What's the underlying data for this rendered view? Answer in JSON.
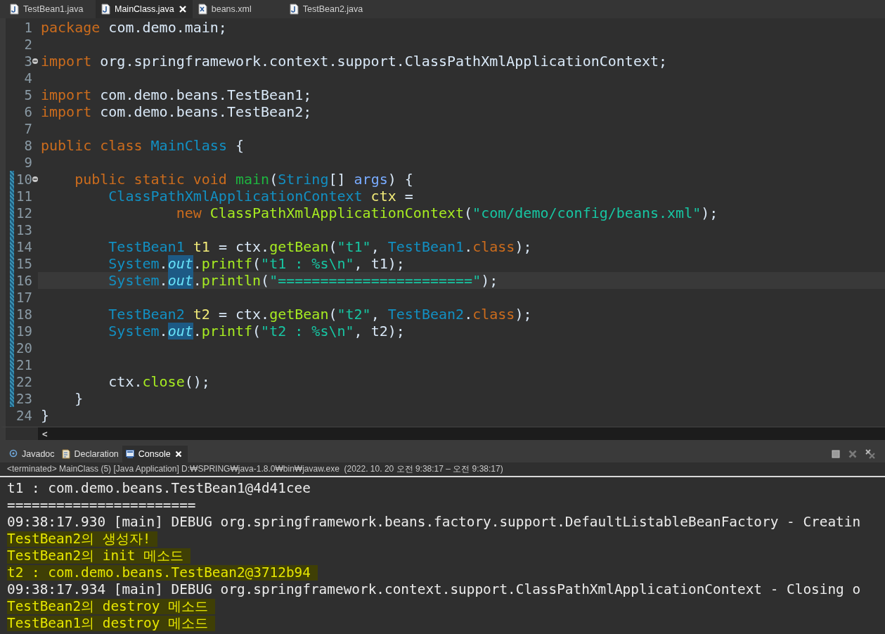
{
  "editor_tabs": [
    {
      "label": "TestBean1.java",
      "kind": "java",
      "selected": false
    },
    {
      "label": "MainClass.java",
      "kind": "java",
      "selected": true
    },
    {
      "label": "beans.xml",
      "kind": "xml",
      "selected": false
    },
    {
      "label": "TestBean2.java",
      "kind": "java",
      "selected": false
    }
  ],
  "code_lines": [
    {
      "number": "1",
      "fold_marker": false,
      "marked": false,
      "current": false,
      "tokens": [
        {
          "kind": "kw",
          "text": "package"
        },
        {
          "kind": "plain",
          "text": " com.demo.main;"
        }
      ]
    },
    {
      "number": "2",
      "fold_marker": false,
      "marked": false,
      "current": false
    },
    {
      "number": "3",
      "fold_marker": true,
      "marked": false,
      "current": false,
      "tokens": [
        {
          "kind": "kw",
          "text": "import"
        },
        {
          "kind": "plain",
          "text": " org.springframework.context.support.ClassPathXmlApplicationContext;"
        }
      ]
    },
    {
      "number": "4",
      "fold_marker": false,
      "marked": false,
      "current": false
    },
    {
      "number": "5",
      "fold_marker": false,
      "marked": false,
      "current": false,
      "tokens": [
        {
          "kind": "kw",
          "text": "import"
        },
        {
          "kind": "plain",
          "text": " com.demo.beans.TestBean1;"
        }
      ]
    },
    {
      "number": "6",
      "fold_marker": false,
      "marked": false,
      "current": false,
      "tokens": [
        {
          "kind": "kw",
          "text": "import"
        },
        {
          "kind": "plain",
          "text": " com.demo.beans.TestBean2;"
        }
      ]
    },
    {
      "number": "7",
      "fold_marker": false,
      "marked": false,
      "current": false
    },
    {
      "number": "8",
      "fold_marker": false,
      "marked": false,
      "current": false,
      "tokens": [
        {
          "kind": "kw",
          "text": "public class "
        },
        {
          "kind": "type",
          "text": "MainClass"
        },
        {
          "kind": "plain",
          "text": " {"
        }
      ]
    },
    {
      "number": "9",
      "fold_marker": false,
      "marked": false,
      "current": false
    },
    {
      "number": "10",
      "fold_marker": true,
      "marked": true,
      "current": false,
      "tokens": [
        {
          "kind": "kw",
          "text": "    public static void "
        },
        {
          "kind": "method_decl",
          "text": "main"
        },
        {
          "kind": "plain",
          "text": "("
        },
        {
          "kind": "type",
          "text": "String"
        },
        {
          "kind": "plain",
          "text": "[] "
        },
        {
          "kind": "param",
          "text": "args"
        },
        {
          "kind": "plain",
          "text": ") {"
        }
      ]
    },
    {
      "number": "11",
      "fold_marker": false,
      "marked": true,
      "current": false,
      "tokens": [
        {
          "kind": "type",
          "text": "        ClassPathXmlApplicationContext "
        },
        {
          "kind": "var_decl",
          "text": "ctx"
        },
        {
          "kind": "plain",
          "text": " ="
        }
      ]
    },
    {
      "number": "12",
      "fold_marker": false,
      "marked": true,
      "current": false,
      "tokens": [
        {
          "kind": "kw",
          "text": "                new "
        },
        {
          "kind": "method",
          "text": "ClassPathXmlApplicationContext"
        },
        {
          "kind": "plain",
          "text": "("
        },
        {
          "kind": "str",
          "text": "\"com/demo/config/beans.xml\""
        },
        {
          "kind": "plain",
          "text": ");"
        }
      ]
    },
    {
      "number": "13",
      "fold_marker": false,
      "marked": true,
      "current": false
    },
    {
      "number": "14",
      "fold_marker": false,
      "marked": true,
      "current": false,
      "tokens": [
        {
          "kind": "type",
          "text": "        TestBean1 "
        },
        {
          "kind": "var_decl",
          "text": "t1"
        },
        {
          "kind": "plain",
          "text": " = ctx."
        },
        {
          "kind": "method",
          "text": "getBean"
        },
        {
          "kind": "plain",
          "text": "("
        },
        {
          "kind": "str",
          "text": "\"t1\""
        },
        {
          "kind": "plain",
          "text": ", "
        },
        {
          "kind": "type",
          "text": "TestBean1"
        },
        {
          "kind": "plain",
          "text": "."
        },
        {
          "kind": "kw",
          "text": "class"
        },
        {
          "kind": "plain",
          "text": ");"
        }
      ]
    },
    {
      "number": "15",
      "fold_marker": false,
      "marked": true,
      "current": false,
      "tokens": [
        {
          "kind": "type",
          "text": "        System"
        },
        {
          "kind": "plain",
          "text": "."
        },
        {
          "kind": "field_occurrence",
          "text": "out"
        },
        {
          "kind": "plain",
          "text": "."
        },
        {
          "kind": "method",
          "text": "printf"
        },
        {
          "kind": "plain",
          "text": "("
        },
        {
          "kind": "str",
          "text": "\"t1 : %s\\n\""
        },
        {
          "kind": "plain",
          "text": ", t1);"
        }
      ]
    },
    {
      "number": "16",
      "fold_marker": false,
      "marked": true,
      "current": true,
      "tokens": [
        {
          "kind": "type",
          "text": "        System"
        },
        {
          "kind": "plain",
          "text": "."
        },
        {
          "kind": "field_occurrence",
          "text": "out"
        },
        {
          "kind": "plain",
          "text": "."
        },
        {
          "kind": "method",
          "text": "println"
        },
        {
          "kind": "plain",
          "text": "("
        },
        {
          "kind": "str",
          "text": "\"=======================\""
        },
        {
          "kind": "plain",
          "text": ");"
        }
      ]
    },
    {
      "number": "17",
      "fold_marker": false,
      "marked": true,
      "current": false
    },
    {
      "number": "18",
      "fold_marker": false,
      "marked": true,
      "current": false,
      "tokens": [
        {
          "kind": "type",
          "text": "        TestBean2 "
        },
        {
          "kind": "var_decl",
          "text": "t2"
        },
        {
          "kind": "plain",
          "text": " = ctx."
        },
        {
          "kind": "method",
          "text": "getBean"
        },
        {
          "kind": "plain",
          "text": "("
        },
        {
          "kind": "str",
          "text": "\"t2\""
        },
        {
          "kind": "plain",
          "text": ", "
        },
        {
          "kind": "type",
          "text": "TestBean2"
        },
        {
          "kind": "plain",
          "text": "."
        },
        {
          "kind": "kw",
          "text": "class"
        },
        {
          "kind": "plain",
          "text": ");"
        }
      ]
    },
    {
      "number": "19",
      "fold_marker": false,
      "marked": true,
      "current": false,
      "tokens": [
        {
          "kind": "type",
          "text": "        System"
        },
        {
          "kind": "plain",
          "text": "."
        },
        {
          "kind": "field_occurrence",
          "text": "out"
        },
        {
          "kind": "plain",
          "text": "."
        },
        {
          "kind": "method",
          "text": "printf"
        },
        {
          "kind": "plain",
          "text": "("
        },
        {
          "kind": "str",
          "text": "\"t2 : %s\\n\""
        },
        {
          "kind": "plain",
          "text": ", t2);"
        }
      ]
    },
    {
      "number": "20",
      "fold_marker": false,
      "marked": true,
      "current": false
    },
    {
      "number": "21",
      "fold_marker": false,
      "marked": true,
      "current": false
    },
    {
      "number": "22",
      "fold_marker": false,
      "marked": true,
      "current": false,
      "tokens": [
        {
          "kind": "plain",
          "text": "        ctx."
        },
        {
          "kind": "method",
          "text": "close"
        },
        {
          "kind": "plain",
          "text": "();"
        }
      ]
    },
    {
      "number": "23",
      "fold_marker": false,
      "marked": true,
      "current": false,
      "tokens": [
        {
          "kind": "plain",
          "text": "    }"
        }
      ]
    },
    {
      "number": "24",
      "fold_marker": false,
      "marked": false,
      "current": false,
      "tokens": [
        {
          "kind": "plain",
          "text": "}"
        }
      ]
    }
  ],
  "scroll_arrow": "<",
  "view_tabs": [
    {
      "label": "Javadoc",
      "selected": false
    },
    {
      "label": "Declaration",
      "selected": false
    },
    {
      "label": "Console",
      "selected": true
    }
  ],
  "console_status": "<terminated> MainClass (5) [Java Application] D:₩SPRING₩java-1.8.0₩bin₩javaw.exe  (2022. 10. 20 오전 9:38:17 – 오전 9:38:17)",
  "console_lines": [
    {
      "text": "t1 : com.demo.beans.TestBean1@4d41cee",
      "highlighted": false
    },
    {
      "text": "=======================",
      "highlighted": false
    },
    {
      "text": "09:38:17.930 [main] DEBUG org.springframework.beans.factory.support.DefaultListableBeanFactory - Creatin",
      "highlighted": false
    },
    {
      "text": "TestBean2의 생성자!",
      "highlighted": true
    },
    {
      "text": "TestBean2의 init 메소드",
      "highlighted": true
    },
    {
      "text": "t2 : com.demo.beans.TestBean2@3712b94",
      "highlighted": true
    },
    {
      "text": "09:38:17.934 [main] DEBUG org.springframework.context.support.ClassPathXmlApplicationContext - Closing o",
      "highlighted": false
    },
    {
      "text": "TestBean2의 destroy 메소드",
      "highlighted": true
    },
    {
      "text": "TestBean1의 destroy 메소드",
      "highlighted": true
    }
  ]
}
